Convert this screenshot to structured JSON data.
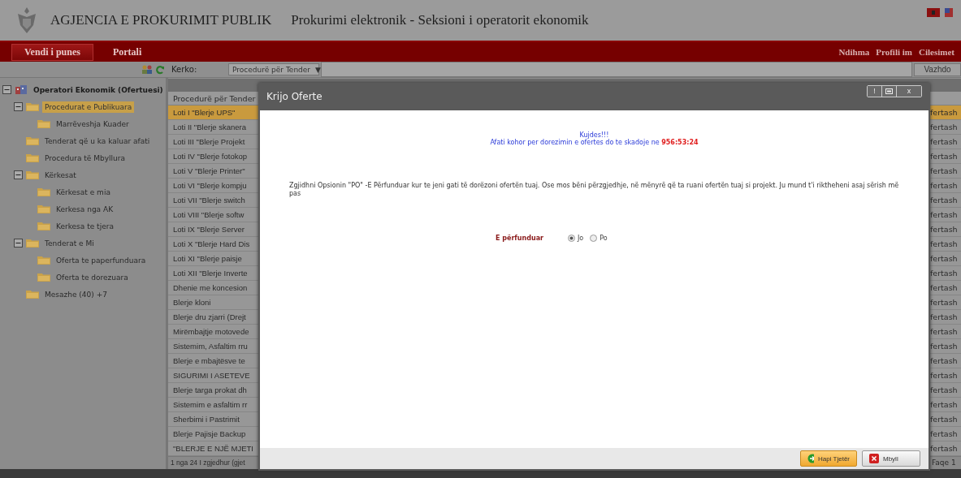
{
  "header": {
    "agency": "AGJENCIA E PROKURIMIT PUBLIK",
    "subtitle": "Prokurimi elektronik - Seksioni i operatorit ekonomik"
  },
  "nav": {
    "tabs": [
      {
        "label": "Vendi i punes",
        "selected": true
      },
      {
        "label": "Portali",
        "selected": false
      }
    ],
    "links": [
      "Ndihma",
      "Profili im",
      "Cilesimet"
    ]
  },
  "toolbar": {
    "search_label": "Kerko:",
    "search_type": "Procedurë për Tender",
    "arrow": "▼",
    "button": "Vazhdo"
  },
  "sidebar": {
    "items": [
      {
        "label": "Operatori Ekonomik (Ofertuesi)",
        "kind": "root",
        "expanded": true,
        "selected": false,
        "children": [
          {
            "label": "Procedurat e Publikuara",
            "kind": "folder",
            "expanded": true,
            "selected": true,
            "children": [
              {
                "label": "Marrëveshja Kuader",
                "kind": "folder",
                "selected": false
              }
            ]
          },
          {
            "label": "Tenderat që u ka kaluar afati",
            "kind": "folder",
            "selected": false
          },
          {
            "label": "Procedura të Mbyllura",
            "kind": "folder",
            "selected": false
          },
          {
            "label": "Kërkesat",
            "kind": "folder",
            "expanded": true,
            "selected": false,
            "children": [
              {
                "label": "Kërkesat e mia",
                "kind": "folder",
                "selected": false
              },
              {
                "label": "Kerkesa nga AK",
                "kind": "folder",
                "selected": false
              },
              {
                "label": "Kerkesa te tjera",
                "kind": "folder",
                "selected": false
              }
            ]
          },
          {
            "label": "Tenderat e Mi",
            "kind": "folder",
            "expanded": true,
            "selected": false,
            "children": [
              {
                "label": "Oferta te paperfunduara",
                "kind": "folder",
                "selected": false
              },
              {
                "label": "Oferta te dorezuara",
                "kind": "folder",
                "selected": false
              }
            ]
          },
          {
            "label": "Mesazhe (40) +7",
            "kind": "folder",
            "selected": false
          }
        ]
      }
    ]
  },
  "table": {
    "columns": [
      "Procedurë për Tender"
    ],
    "rows": [
      {
        "name": "Loti I \"Blerje UPS\"",
        "column_2": "fertash",
        "selected": true
      },
      {
        "name": "Loti II \"Blerje skanera",
        "column_2": "fertash",
        "selected": false
      },
      {
        "name": "Loti III \"Blerje Projekt",
        "column_2": "fertash",
        "selected": false
      },
      {
        "name": "Loti IV \"Blerje fotokop",
        "column_2": "fertash",
        "selected": false
      },
      {
        "name": "Loti V \"Blerje Printer\"",
        "column_2": "fertash",
        "selected": false
      },
      {
        "name": "Loti VI \"Blerje kompju",
        "column_2": "fertash",
        "selected": false
      },
      {
        "name": "Loti VII \"Blerje switch",
        "column_2": "fertash",
        "selected": false
      },
      {
        "name": "Loti VIII \"Blerje softw",
        "column_2": "fertash",
        "selected": false
      },
      {
        "name": "Loti IX \"Blerje Server",
        "column_2": "fertash",
        "selected": false
      },
      {
        "name": "Loti X \"Blerje Hard Dis",
        "column_2": "fertash",
        "selected": false
      },
      {
        "name": "Loti XI \"Blerje paisje",
        "column_2": "fertash",
        "selected": false
      },
      {
        "name": "Loti XII \"Blerje Inverte",
        "column_2": "fertash",
        "selected": false
      },
      {
        "name": "Dhenie me koncesion",
        "column_2": "fertash",
        "selected": false
      },
      {
        "name": "Blerje kloni",
        "column_2": "fertash",
        "selected": false
      },
      {
        "name": "Blerje dru zjarri (Drejt",
        "column_2": "fertash",
        "selected": false
      },
      {
        "name": "Mirëmbajtje motovede",
        "column_2": "fertash",
        "selected": false
      },
      {
        "name": "Sistemim, Asfaltim rru",
        "column_2": "fertash",
        "selected": false
      },
      {
        "name": "Blerje e mbajtësve te",
        "column_2": "fertash",
        "selected": false
      },
      {
        "name": "SIGURIMI I ASETEVE",
        "column_2": "fertash",
        "selected": false
      },
      {
        "name": "Blerje targa prokat dh",
        "column_2": "fertash",
        "selected": false
      },
      {
        "name": "Sistemim e asfaltim rr",
        "column_2": "fertash",
        "selected": false
      },
      {
        "name": "Sherbimi i Pastrimit",
        "column_2": "fertash",
        "selected": false
      },
      {
        "name": "Blerje Pajisje Backup",
        "column_2": "fertash",
        "selected": false
      },
      {
        "name": "\"BLERJE E NJË MJETI",
        "column_2": "fertash",
        "selected": false
      }
    ],
    "pager_left": "1 nga 24 I zgjedhur (gjet",
    "pager_right": "Faqe 1"
  },
  "dialog": {
    "title": "Krijo Oferte",
    "controls": [
      "!",
      "x"
    ],
    "warning": "Kujdes!!!",
    "deadline": "Afati kohor per dorezimin e ofertes do te skadoje ne **956:53:24**",
    "instructions": "Zgjidhni Opsionin \"PO\" -E Përfunduar kur te jeni gati të dorëzoni ofertën tuaj. Ose mos bëni përzgjedhje, në mënyrë që ta ruani ofertën tuaj si projekt. Ju mund t'i riktheheni asaj sërish më pas",
    "field_label": "E përfunduar",
    "options": [
      {
        "label": "Jo",
        "selected": true
      },
      {
        "label": "Po",
        "selected": false
      }
    ],
    "buttons": [
      {
        "label": "Hapi Tjetër",
        "kind": "next"
      },
      {
        "label": "Mbyll",
        "kind": "close"
      }
    ]
  }
}
